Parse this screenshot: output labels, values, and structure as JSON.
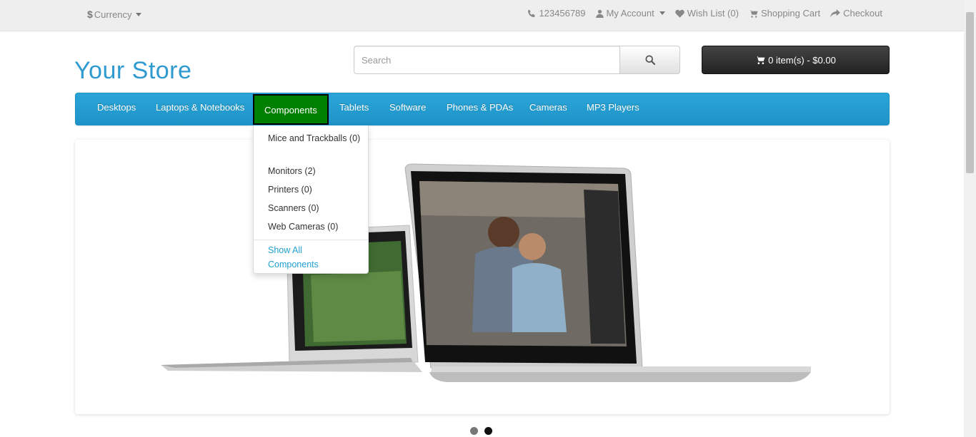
{
  "topbar": {
    "currency_symbol": "$",
    "currency_label": "Currency",
    "phone": "123456789",
    "my_account": "My Account",
    "wish_list": "Wish List (0)",
    "shopping_cart": "Shopping Cart",
    "checkout": "Checkout"
  },
  "header": {
    "logo": "Your Store",
    "search_placeholder": "Search",
    "cart_label": "0 item(s) - $0.00"
  },
  "menu": {
    "items": [
      "Desktops",
      "Laptops & Notebooks",
      "Components",
      "Tablets",
      "Software",
      "Phones & PDAs",
      "Cameras",
      "MP3 Players"
    ],
    "active": "Components",
    "active_color": "#008000",
    "bar_color": "#229ac8"
  },
  "dropdown": {
    "items": [
      "Mice and Trackballs (0)",
      "Monitors (2)",
      "Printers (0)",
      "Scanners (0)",
      "Web Cameras (0)"
    ],
    "show_all": "Show All Components"
  },
  "slideshow": {
    "dot_count": 2,
    "active_dot": 2
  },
  "colors": {
    "accent": "#23a1d1",
    "logo": "#2e9ad0"
  }
}
